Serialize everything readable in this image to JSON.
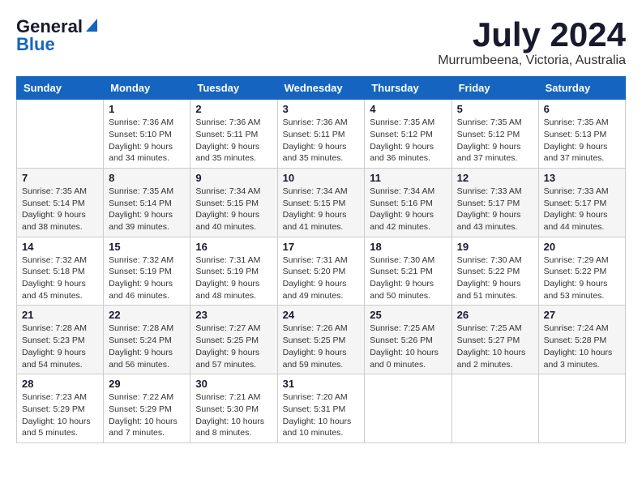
{
  "header": {
    "logo_general": "General",
    "logo_blue": "Blue",
    "month_title": "July 2024",
    "location": "Murrumbeena, Victoria, Australia"
  },
  "weekdays": [
    "Sunday",
    "Monday",
    "Tuesday",
    "Wednesday",
    "Thursday",
    "Friday",
    "Saturday"
  ],
  "weeks": [
    [
      {
        "day": "",
        "sunrise": "",
        "sunset": "",
        "daylight": ""
      },
      {
        "day": "1",
        "sunrise": "Sunrise: 7:36 AM",
        "sunset": "Sunset: 5:10 PM",
        "daylight": "Daylight: 9 hours and 34 minutes."
      },
      {
        "day": "2",
        "sunrise": "Sunrise: 7:36 AM",
        "sunset": "Sunset: 5:11 PM",
        "daylight": "Daylight: 9 hours and 35 minutes."
      },
      {
        "day": "3",
        "sunrise": "Sunrise: 7:36 AM",
        "sunset": "Sunset: 5:11 PM",
        "daylight": "Daylight: 9 hours and 35 minutes."
      },
      {
        "day": "4",
        "sunrise": "Sunrise: 7:35 AM",
        "sunset": "Sunset: 5:12 PM",
        "daylight": "Daylight: 9 hours and 36 minutes."
      },
      {
        "day": "5",
        "sunrise": "Sunrise: 7:35 AM",
        "sunset": "Sunset: 5:12 PM",
        "daylight": "Daylight: 9 hours and 37 minutes."
      },
      {
        "day": "6",
        "sunrise": "Sunrise: 7:35 AM",
        "sunset": "Sunset: 5:13 PM",
        "daylight": "Daylight: 9 hours and 37 minutes."
      }
    ],
    [
      {
        "day": "7",
        "sunrise": "Sunrise: 7:35 AM",
        "sunset": "Sunset: 5:14 PM",
        "daylight": "Daylight: 9 hours and 38 minutes."
      },
      {
        "day": "8",
        "sunrise": "Sunrise: 7:35 AM",
        "sunset": "Sunset: 5:14 PM",
        "daylight": "Daylight: 9 hours and 39 minutes."
      },
      {
        "day": "9",
        "sunrise": "Sunrise: 7:34 AM",
        "sunset": "Sunset: 5:15 PM",
        "daylight": "Daylight: 9 hours and 40 minutes."
      },
      {
        "day": "10",
        "sunrise": "Sunrise: 7:34 AM",
        "sunset": "Sunset: 5:15 PM",
        "daylight": "Daylight: 9 hours and 41 minutes."
      },
      {
        "day": "11",
        "sunrise": "Sunrise: 7:34 AM",
        "sunset": "Sunset: 5:16 PM",
        "daylight": "Daylight: 9 hours and 42 minutes."
      },
      {
        "day": "12",
        "sunrise": "Sunrise: 7:33 AM",
        "sunset": "Sunset: 5:17 PM",
        "daylight": "Daylight: 9 hours and 43 minutes."
      },
      {
        "day": "13",
        "sunrise": "Sunrise: 7:33 AM",
        "sunset": "Sunset: 5:17 PM",
        "daylight": "Daylight: 9 hours and 44 minutes."
      }
    ],
    [
      {
        "day": "14",
        "sunrise": "Sunrise: 7:32 AM",
        "sunset": "Sunset: 5:18 PM",
        "daylight": "Daylight: 9 hours and 45 minutes."
      },
      {
        "day": "15",
        "sunrise": "Sunrise: 7:32 AM",
        "sunset": "Sunset: 5:19 PM",
        "daylight": "Daylight: 9 hours and 46 minutes."
      },
      {
        "day": "16",
        "sunrise": "Sunrise: 7:31 AM",
        "sunset": "Sunset: 5:19 PM",
        "daylight": "Daylight: 9 hours and 48 minutes."
      },
      {
        "day": "17",
        "sunrise": "Sunrise: 7:31 AM",
        "sunset": "Sunset: 5:20 PM",
        "daylight": "Daylight: 9 hours and 49 minutes."
      },
      {
        "day": "18",
        "sunrise": "Sunrise: 7:30 AM",
        "sunset": "Sunset: 5:21 PM",
        "daylight": "Daylight: 9 hours and 50 minutes."
      },
      {
        "day": "19",
        "sunrise": "Sunrise: 7:30 AM",
        "sunset": "Sunset: 5:22 PM",
        "daylight": "Daylight: 9 hours and 51 minutes."
      },
      {
        "day": "20",
        "sunrise": "Sunrise: 7:29 AM",
        "sunset": "Sunset: 5:22 PM",
        "daylight": "Daylight: 9 hours and 53 minutes."
      }
    ],
    [
      {
        "day": "21",
        "sunrise": "Sunrise: 7:28 AM",
        "sunset": "Sunset: 5:23 PM",
        "daylight": "Daylight: 9 hours and 54 minutes."
      },
      {
        "day": "22",
        "sunrise": "Sunrise: 7:28 AM",
        "sunset": "Sunset: 5:24 PM",
        "daylight": "Daylight: 9 hours and 56 minutes."
      },
      {
        "day": "23",
        "sunrise": "Sunrise: 7:27 AM",
        "sunset": "Sunset: 5:25 PM",
        "daylight": "Daylight: 9 hours and 57 minutes."
      },
      {
        "day": "24",
        "sunrise": "Sunrise: 7:26 AM",
        "sunset": "Sunset: 5:25 PM",
        "daylight": "Daylight: 9 hours and 59 minutes."
      },
      {
        "day": "25",
        "sunrise": "Sunrise: 7:25 AM",
        "sunset": "Sunset: 5:26 PM",
        "daylight": "Daylight: 10 hours and 0 minutes."
      },
      {
        "day": "26",
        "sunrise": "Sunrise: 7:25 AM",
        "sunset": "Sunset: 5:27 PM",
        "daylight": "Daylight: 10 hours and 2 minutes."
      },
      {
        "day": "27",
        "sunrise": "Sunrise: 7:24 AM",
        "sunset": "Sunset: 5:28 PM",
        "daylight": "Daylight: 10 hours and 3 minutes."
      }
    ],
    [
      {
        "day": "28",
        "sunrise": "Sunrise: 7:23 AM",
        "sunset": "Sunset: 5:29 PM",
        "daylight": "Daylight: 10 hours and 5 minutes."
      },
      {
        "day": "29",
        "sunrise": "Sunrise: 7:22 AM",
        "sunset": "Sunset: 5:29 PM",
        "daylight": "Daylight: 10 hours and 7 minutes."
      },
      {
        "day": "30",
        "sunrise": "Sunrise: 7:21 AM",
        "sunset": "Sunset: 5:30 PM",
        "daylight": "Daylight: 10 hours and 8 minutes."
      },
      {
        "day": "31",
        "sunrise": "Sunrise: 7:20 AM",
        "sunset": "Sunset: 5:31 PM",
        "daylight": "Daylight: 10 hours and 10 minutes."
      },
      {
        "day": "",
        "sunrise": "",
        "sunset": "",
        "daylight": ""
      },
      {
        "day": "",
        "sunrise": "",
        "sunset": "",
        "daylight": ""
      },
      {
        "day": "",
        "sunrise": "",
        "sunset": "",
        "daylight": ""
      }
    ]
  ]
}
